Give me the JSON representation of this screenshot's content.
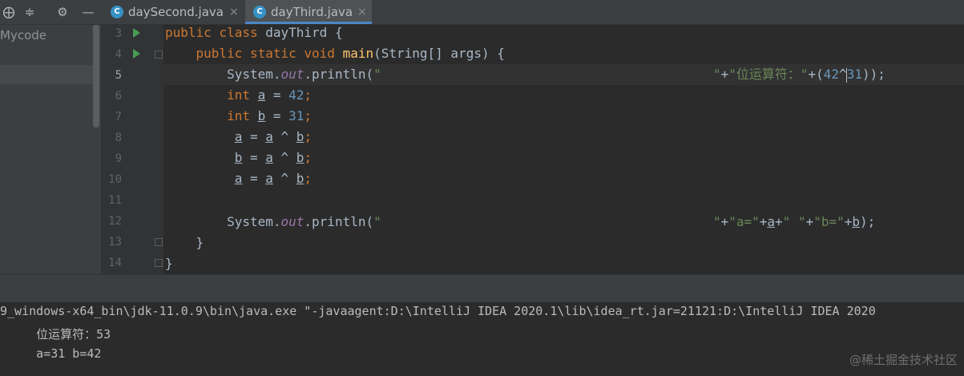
{
  "toolbar": {
    "icons": [
      "target-icon",
      "collapse-icon",
      "gear-icon",
      "minimize-icon"
    ],
    "glyphs": [
      "⨁",
      "≑",
      "⚙",
      "—"
    ]
  },
  "tabs": [
    {
      "label": "daySecond.java",
      "icon": "java-class-icon",
      "active": false,
      "close": "×"
    },
    {
      "label": "dayThird.java",
      "icon": "java-class-icon",
      "active": true,
      "close": "×"
    }
  ],
  "project": {
    "label": "Mycode"
  },
  "editor": {
    "line_numbers": [
      "3",
      "4",
      "5",
      "6",
      "7",
      "8",
      "9",
      "10",
      "11",
      "12",
      "13",
      "14"
    ],
    "current_line": "5"
  },
  "code": {
    "l3": {
      "kw": "public class",
      "name": "dayThird",
      "brace": "{"
    },
    "l4": {
      "kw": "public static void",
      "fn": "main",
      "args": "(String[] args) {"
    },
    "l5": {
      "sys": "System.",
      "out": "out",
      "println": ".println(",
      "s1": "\"                                           \"",
      "plus1": "+",
      "s2": "\"位运算符：\"",
      "plus2": "+(",
      "n1": "42",
      "op": "^",
      "n2": "31",
      "end": "));"
    },
    "l6": {
      "kw": "int",
      "var": "a",
      "eq": " = ",
      "num": "42",
      "semi": ";"
    },
    "l7": {
      "kw": "int",
      "var": "b",
      "eq": " = ",
      "num": "31",
      "semi": ";"
    },
    "l8": {
      "lhs": "a",
      "mid": " = ",
      "v1": "a",
      "op": " ^ ",
      "v2": "b",
      "semi": ";"
    },
    "l9": {
      "lhs": "b",
      "mid": " = ",
      "v1": "a",
      "op": " ^ ",
      "v2": "b",
      "semi": ";"
    },
    "l10": {
      "lhs": "a",
      "mid": " = ",
      "v1": "a",
      "op": " ^ ",
      "v2": "b",
      "semi": ";"
    },
    "l12": {
      "sys": "System.",
      "out": "out",
      "println": ".println(",
      "s1": "\"                                           \"",
      "plus1": "+",
      "s2": "\"a=\"",
      "plus2": "+",
      "v1": "a",
      "plus3": "+",
      "s3": "\" \"",
      "plus4": "+",
      "s4": "\"b=\"",
      "plus5": "+",
      "v2": "b",
      "end": ");"
    },
    "l13": "}",
    "l14": "}"
  },
  "console": {
    "command": "9_windows-x64_bin\\jdk-11.0.9\\bin\\java.exe \"-javaagent:D:\\IntelliJ IDEA 2020.1\\lib\\idea_rt.jar=21121:D:\\IntelliJ IDEA 2020",
    "output": [
      "     位运算符：53",
      "     a=31 b=42"
    ]
  },
  "watermark": "@稀土掘金技术社区"
}
